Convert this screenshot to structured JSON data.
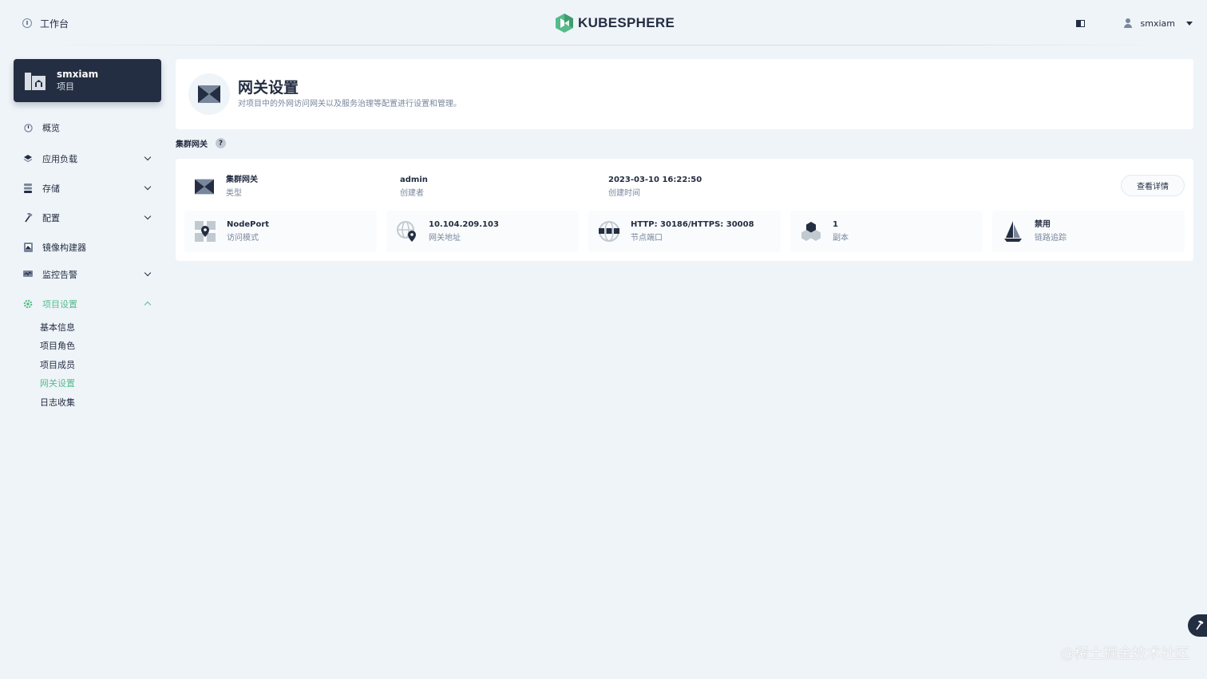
{
  "header": {
    "workbench_label": "工作台",
    "logo_text": "KUBESPHERE",
    "user_name": "smxiam"
  },
  "colors": {
    "accent": "#55bc8a",
    "dark": "#242e42",
    "muted": "#79879c",
    "background": "#eff4f9"
  },
  "sidebar": {
    "project": {
      "name": "smxiam",
      "type": "项目"
    },
    "items": [
      {
        "label": "概览",
        "icon": "dashboard-icon",
        "expandable": false
      },
      {
        "label": "应用负载",
        "icon": "layers-icon",
        "expandable": true
      },
      {
        "label": "存储",
        "icon": "database-icon",
        "expandable": true
      },
      {
        "label": "配置",
        "icon": "hammer-icon",
        "expandable": true
      },
      {
        "label": "镜像构建器",
        "icon": "image-builder-icon",
        "expandable": false
      },
      {
        "label": "监控告警",
        "icon": "monitor-icon",
        "expandable": true
      },
      {
        "label": "项目设置",
        "icon": "gear-icon",
        "expandable": true,
        "expanded": true
      }
    ],
    "settings_sub": [
      "基本信息",
      "项目角色",
      "项目成员",
      "网关设置",
      "日志收集"
    ],
    "settings_sub_active": "网关设置"
  },
  "banner": {
    "title": "网关设置",
    "description": "对项目中的外网访问网关以及服务治理等配置进行设置和管理。"
  },
  "section": {
    "title": "集群网关",
    "help_icon": "?"
  },
  "gateway": {
    "type_value": "集群网关",
    "type_label": "类型",
    "creator_value": "admin",
    "creator_label": "创建者",
    "created_value": "2023-03-10 16:22:50",
    "created_label": "创建时间",
    "detail_button": "查看详情",
    "stats": [
      {
        "value": "NodePort",
        "label": "访问模式",
        "icon": "nodeport-icon"
      },
      {
        "value": "10.104.209.103",
        "label": "网关地址",
        "icon": "globe-pin-icon"
      },
      {
        "value": "HTTP: 30186/HTTPS: 30008",
        "label": "节点端口",
        "icon": "network-icon"
      },
      {
        "value": "1",
        "label": "副本",
        "icon": "replicas-icon"
      },
      {
        "value": "禁用",
        "label": "链路追踪",
        "icon": "sail-icon"
      }
    ]
  },
  "watermark": "@稀土掘金技术社区"
}
